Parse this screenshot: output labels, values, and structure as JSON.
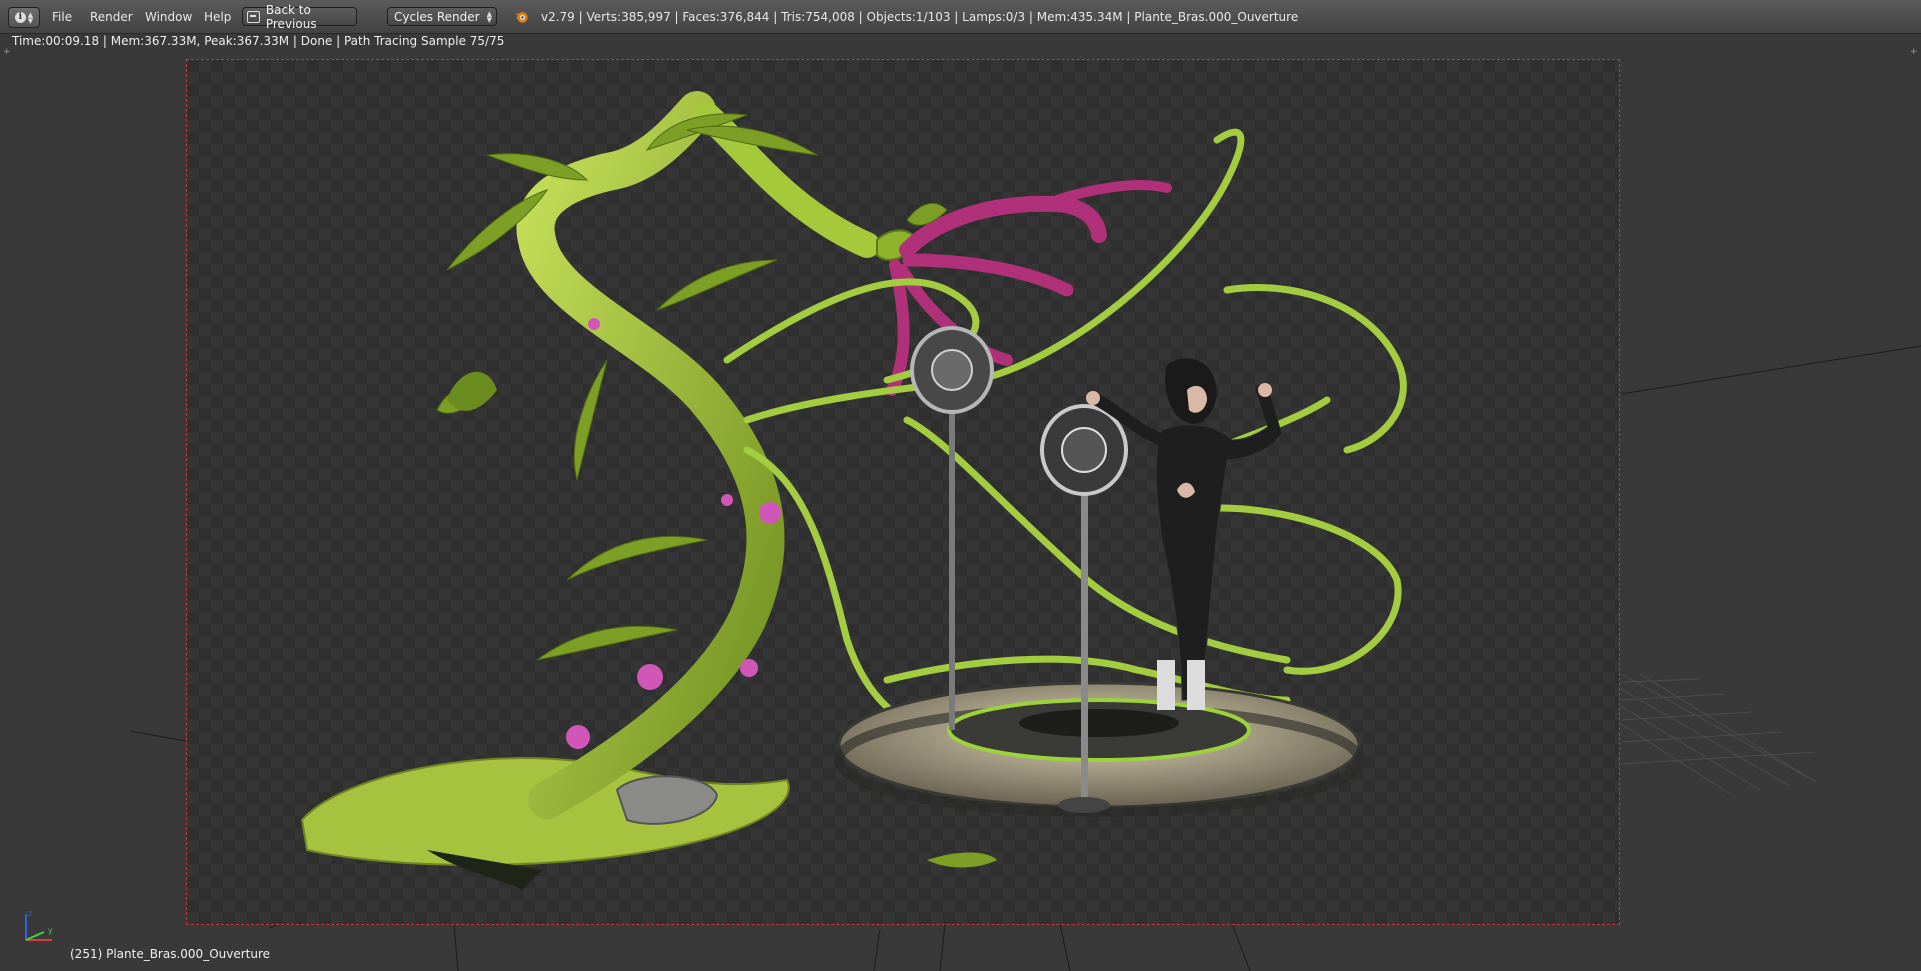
{
  "header": {
    "menus": [
      "File",
      "Render",
      "Window",
      "Help"
    ],
    "back_button_label": "Back to Previous",
    "render_engine": "Cycles Render",
    "stats": "v2.79 | Verts:385,997 | Faces:376,844 | Tris:754,008 | Objects:1/103 | Lamps:0/3 | Mem:435.34M | Plante_Bras.000_Ouverture"
  },
  "viewport": {
    "render_info": "Time:00:09.18 | Mem:367.33M, Peak:367.33M | Done | Path Tracing Sample 75/75",
    "object_label": "(251) Plante_Bras.000_Ouverture",
    "axis": {
      "x_label": "",
      "y_label": "y",
      "z_label": "z"
    }
  },
  "colors": {
    "header_bg": "#4e4e4e",
    "viewport_bg": "#393939",
    "render_border": "#c33a3a",
    "plant_green": "#9fc43a",
    "tentacle_magenta": "#b0307a"
  },
  "icons": {
    "editor_type": "info-icon",
    "back": "back-arrow-icon",
    "blender": "blender-logo-icon"
  }
}
